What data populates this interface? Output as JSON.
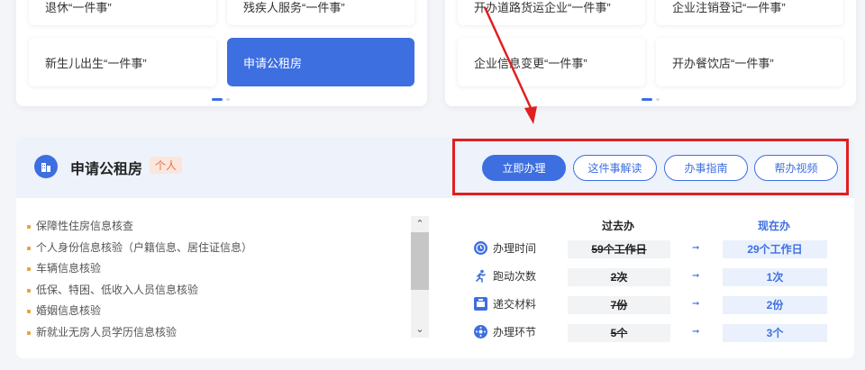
{
  "top_left_tiles": [
    {
      "label": "退休“一件事”"
    },
    {
      "label": "残疾人服务“一件事”"
    },
    {
      "label": "新生儿出生“一件事”"
    },
    {
      "label": "申请公租房"
    }
  ],
  "top_right_tiles": [
    {
      "label": "开办道路货运企业“一件事”"
    },
    {
      "label": "企业注销登记“一件事”"
    },
    {
      "label": "企业信息变更“一件事”"
    },
    {
      "label": "开办餐饮店“一件事”"
    }
  ],
  "service": {
    "title": "申请公租房",
    "badge": "个人",
    "buttons": {
      "apply": "立即办理",
      "explain": "这件事解读",
      "guide": "办事指南",
      "video": "帮办视频"
    }
  },
  "checks": [
    "保障性住房信息核查",
    "个人身份信息核验（户籍信息、居住证信息）",
    "车辆信息核验",
    "低保、特困、低收入人员信息核验",
    "婚姻信息核验",
    "新就业无房人员学历信息核验"
  ],
  "compare": {
    "past_header": "过去办",
    "now_header": "现在办",
    "rows": [
      {
        "label": "办理时间",
        "past": "59个工作日",
        "now": "29个工作日",
        "icon": "clock-icon"
      },
      {
        "label": "跑动次数",
        "past": "2次",
        "now": "1次",
        "icon": "running-icon"
      },
      {
        "label": "递交材料",
        "past": "7份",
        "now": "2份",
        "icon": "folder-icon"
      },
      {
        "label": "办理环节",
        "past": "5个",
        "now": "3个",
        "icon": "process-icon"
      }
    ]
  },
  "colors": {
    "accent": "#3e6fe0",
    "highlight": "#e02020",
    "badge": "#e1734a"
  }
}
